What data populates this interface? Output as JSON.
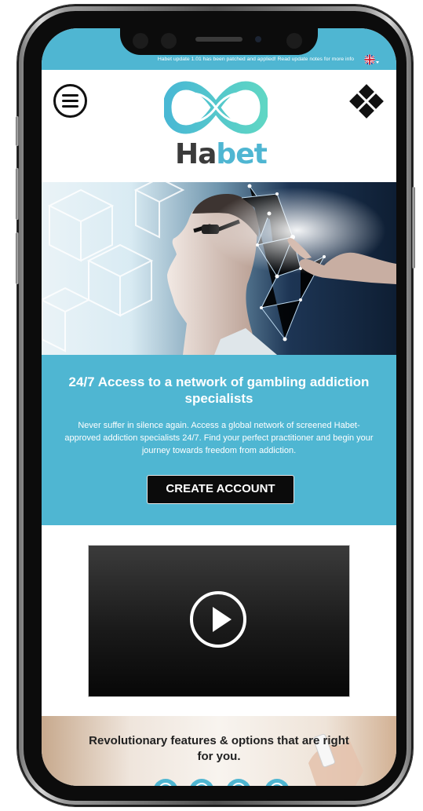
{
  "notice": {
    "text": "Habet update 1.01 has been patched and applied! Read update notes for more info"
  },
  "language": {
    "current": "English (UK)",
    "icon": "uk-flag-icon"
  },
  "header": {
    "menu_icon": "hamburger-menu-icon",
    "logo": {
      "part1": "Ha",
      "part2": "bet"
    },
    "grid_icon": "grid-menu-icon"
  },
  "hero": {
    "image": "man-touching-digital-network"
  },
  "promo": {
    "title": "24/7 Access to a network of gambling addiction specialists",
    "description": "Never suffer in silence again. Access a global network of screened Habet-approved addiction specialists 24/7. Find your perfect practitioner and begin your journey towards freedom from addiction.",
    "cta_label": "CREATE ACCOUNT"
  },
  "video": {
    "play_icon": "play-icon"
  },
  "features": {
    "title": "Revolutionary features & options that are right for you."
  },
  "colors": {
    "brand": "#4fb6d2",
    "dark": "#0b0b0b",
    "text_dark": "#222222",
    "logo_dark": "#3b3b3b"
  }
}
